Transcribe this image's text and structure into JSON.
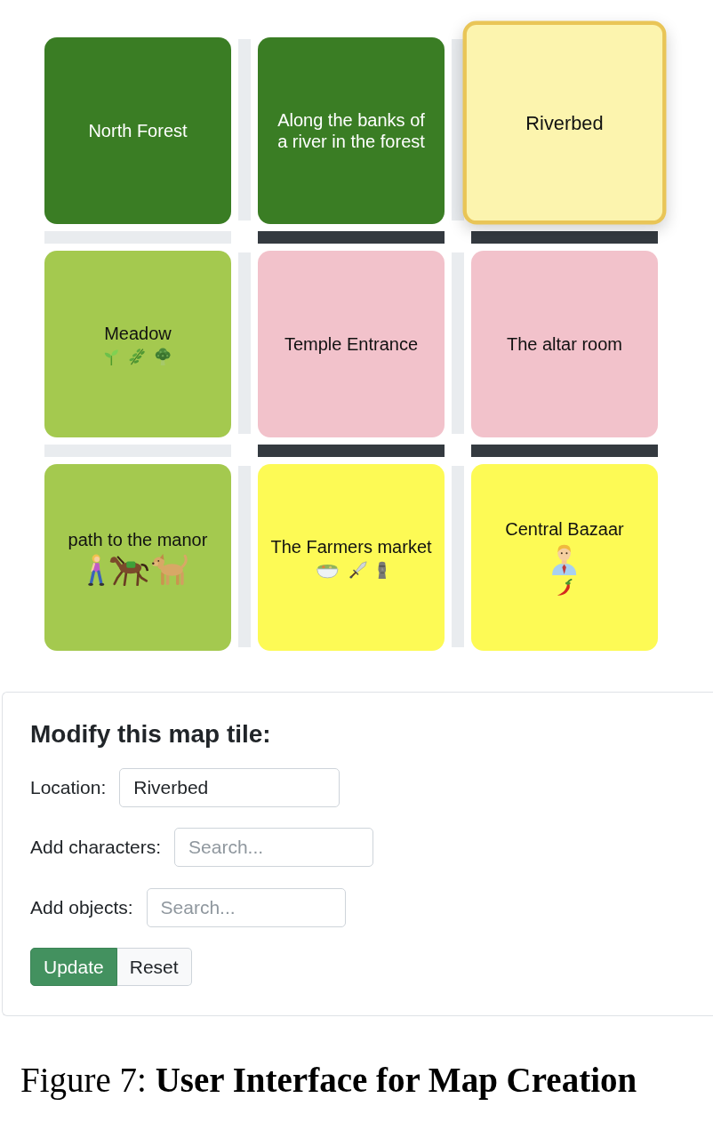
{
  "map": {
    "rows": [
      {
        "tiles": [
          {
            "location": "North Forest",
            "color": "#3a7d24",
            "selected": false
          },
          {
            "location": "Along the banks of a river in the forest",
            "color": "#3a7d24",
            "selected": false
          },
          {
            "location": "Riverbed",
            "color": "#fcf4ae",
            "selected": true
          }
        ],
        "links_between": [
          {
            "on": false
          },
          {
            "on": false
          }
        ],
        "links_below": [
          {
            "on": false
          },
          {
            "on": true
          },
          {
            "on": true
          }
        ]
      },
      {
        "tiles": [
          {
            "location": "Meadow",
            "color": "#a4c94f",
            "selected": false,
            "objects": [
              {
                "kind": "seedling"
              },
              {
                "kind": "herb"
              },
              {
                "kind": "broccoli"
              }
            ]
          },
          {
            "location": "Temple Entrance",
            "color": "#f2c2cb",
            "selected": false
          },
          {
            "location": "The altar room",
            "color": "#f2c2cb",
            "selected": false
          }
        ],
        "links_between": [
          {
            "on": false
          },
          {
            "on": false
          }
        ],
        "links_below": [
          {
            "on": false
          },
          {
            "on": true
          },
          {
            "on": true
          }
        ]
      },
      {
        "tiles": [
          {
            "location": "path to the manor",
            "color": "#a4c94f",
            "selected": false,
            "characters": [
              {
                "kind": "walker"
              },
              {
                "kind": "horse"
              },
              {
                "kind": "dog"
              }
            ]
          },
          {
            "location": "The Farmers market",
            "color": "#fdfa55",
            "selected": false,
            "objects": [
              {
                "kind": "bowl"
              },
              {
                "kind": "dagger"
              },
              {
                "kind": "moai"
              }
            ]
          },
          {
            "location": "Central Bazaar",
            "color": "#fdfa55",
            "selected": false,
            "characters": [
              {
                "kind": "businessman"
              }
            ],
            "objects": [
              {
                "kind": "chili"
              }
            ]
          }
        ],
        "links_between": [
          {
            "on": false
          },
          {
            "on": false
          }
        ]
      }
    ]
  },
  "form": {
    "title": "Modify this map tile:",
    "fields": [
      {
        "label": "Location:",
        "kind": "text",
        "value": "Riverbed"
      },
      {
        "label": "Add characters:",
        "kind": "search",
        "placeholder": "Search..."
      },
      {
        "label": "Add objects:",
        "kind": "search",
        "placeholder": "Search..."
      }
    ],
    "buttons": [
      {
        "label": "Update",
        "kind": "primary"
      },
      {
        "label": "Reset",
        "kind": "secondary"
      }
    ]
  },
  "caption": "Figure 7: **User Interface for Map Creation**"
}
